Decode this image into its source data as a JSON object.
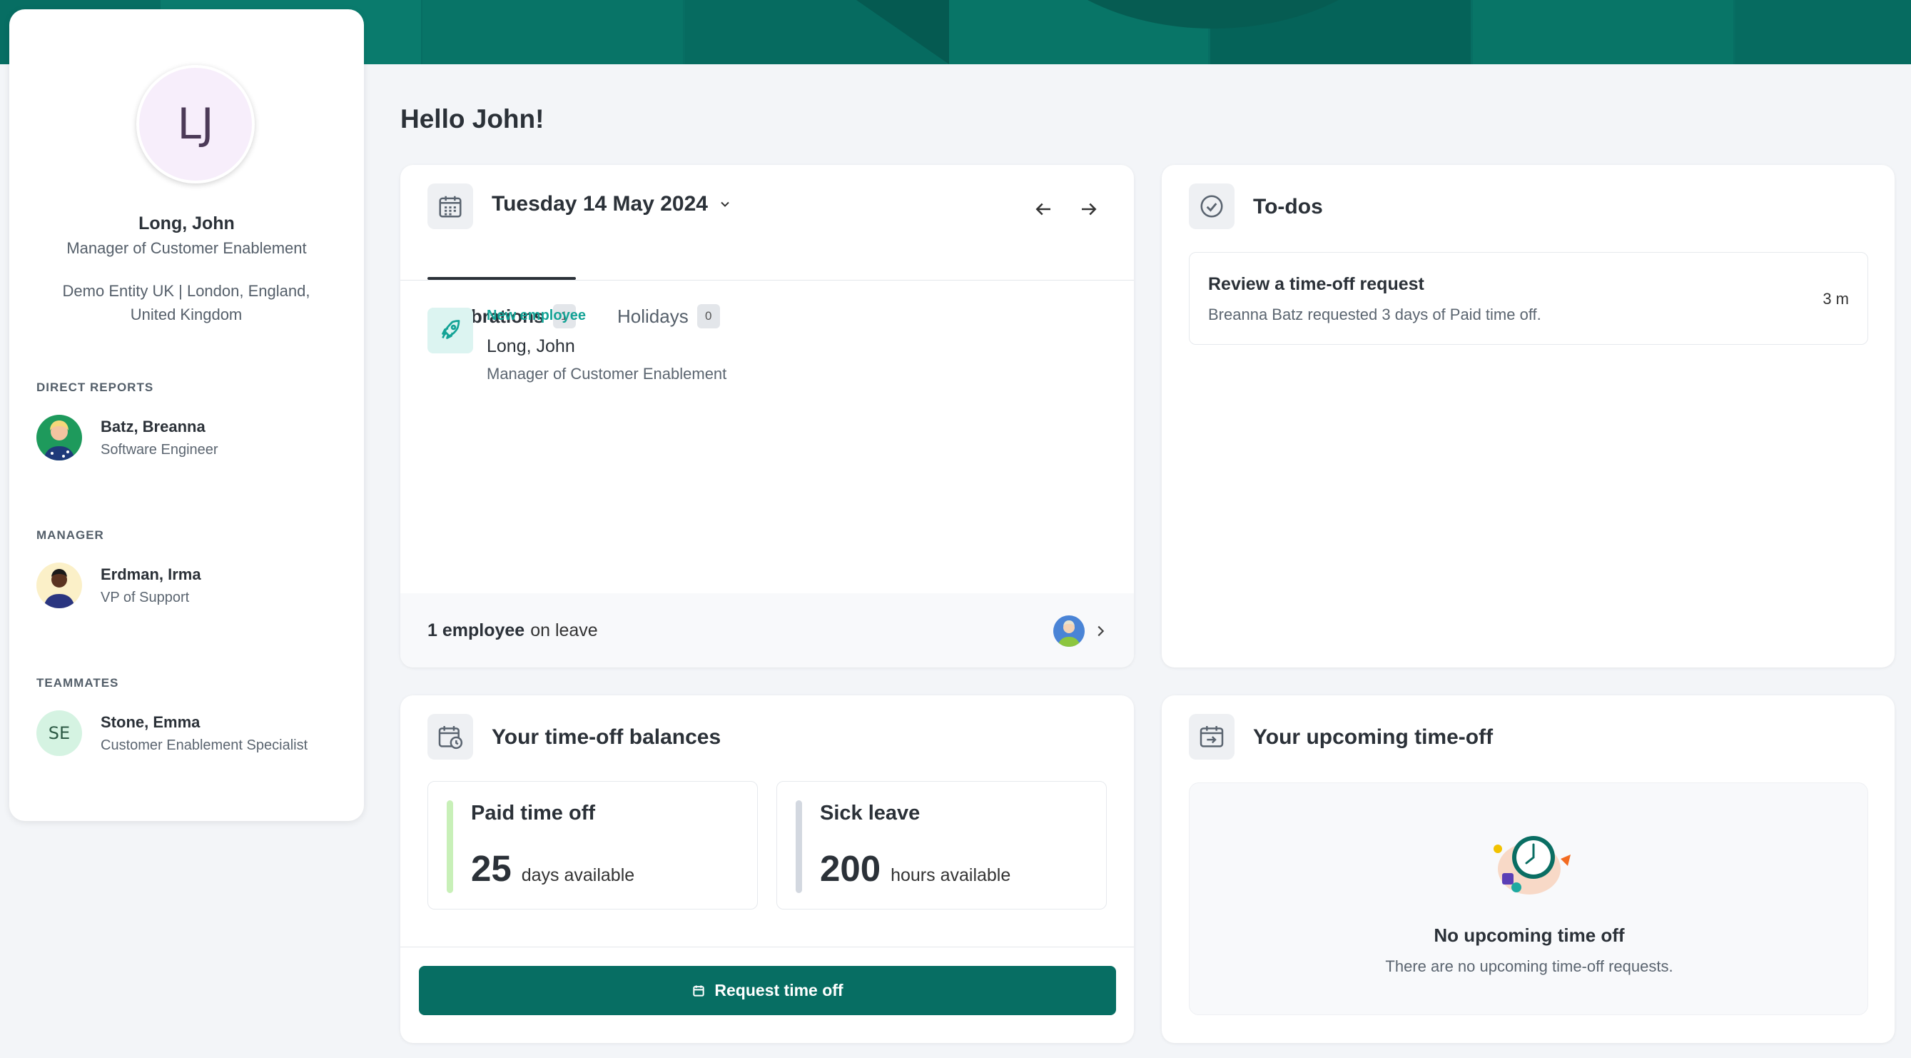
{
  "profile": {
    "initials": "LJ",
    "name": "Long, John",
    "title": "Manager of Customer Enablement",
    "location": "Demo Entity UK | London, England, United Kingdom",
    "direct_reports_heading": "DIRECT REPORTS",
    "direct_reports": [
      {
        "name": "Batz, Breanna",
        "role": "Software Engineer"
      }
    ],
    "manager_heading": "MANAGER",
    "manager": {
      "name": "Erdman, Irma",
      "role": "VP of Support"
    },
    "teammates_heading": "TEAMMATES",
    "teammates": [
      {
        "initials": "SE",
        "name": "Stone, Emma",
        "role": "Customer Enablement Specialist"
      }
    ]
  },
  "greeting": "Hello John!",
  "calendar": {
    "date": "Tuesday 14 May 2024",
    "tabs": [
      {
        "label": "Celebrations",
        "count": "1"
      },
      {
        "label": "Holidays",
        "count": "0"
      }
    ],
    "celebration": {
      "type": "New employee",
      "name": "Long, John",
      "role": "Manager of Customer Enablement"
    },
    "leave_count": "1 employee",
    "leave_suffix": "on leave"
  },
  "todos": {
    "title": "To-dos",
    "items": [
      {
        "title": "Review a time-off request",
        "desc": "Breanna Batz requested 3 days of Paid time off.",
        "age": "3 m"
      }
    ]
  },
  "balances": {
    "title": "Your time-off balances",
    "items": [
      {
        "name": "Paid time off",
        "value": "25",
        "unit": "days available",
        "color": "#c8f0b8"
      },
      {
        "name": "Sick leave",
        "value": "200",
        "unit": "hours available",
        "color": "#d3d8e0"
      }
    ],
    "request_button": "Request time off"
  },
  "upcoming": {
    "title": "Your upcoming time-off",
    "empty_title": "No upcoming time off",
    "empty_desc": "There are no upcoming time-off requests."
  },
  "colors": {
    "brand": "#076e63",
    "accent": "#14a396"
  }
}
